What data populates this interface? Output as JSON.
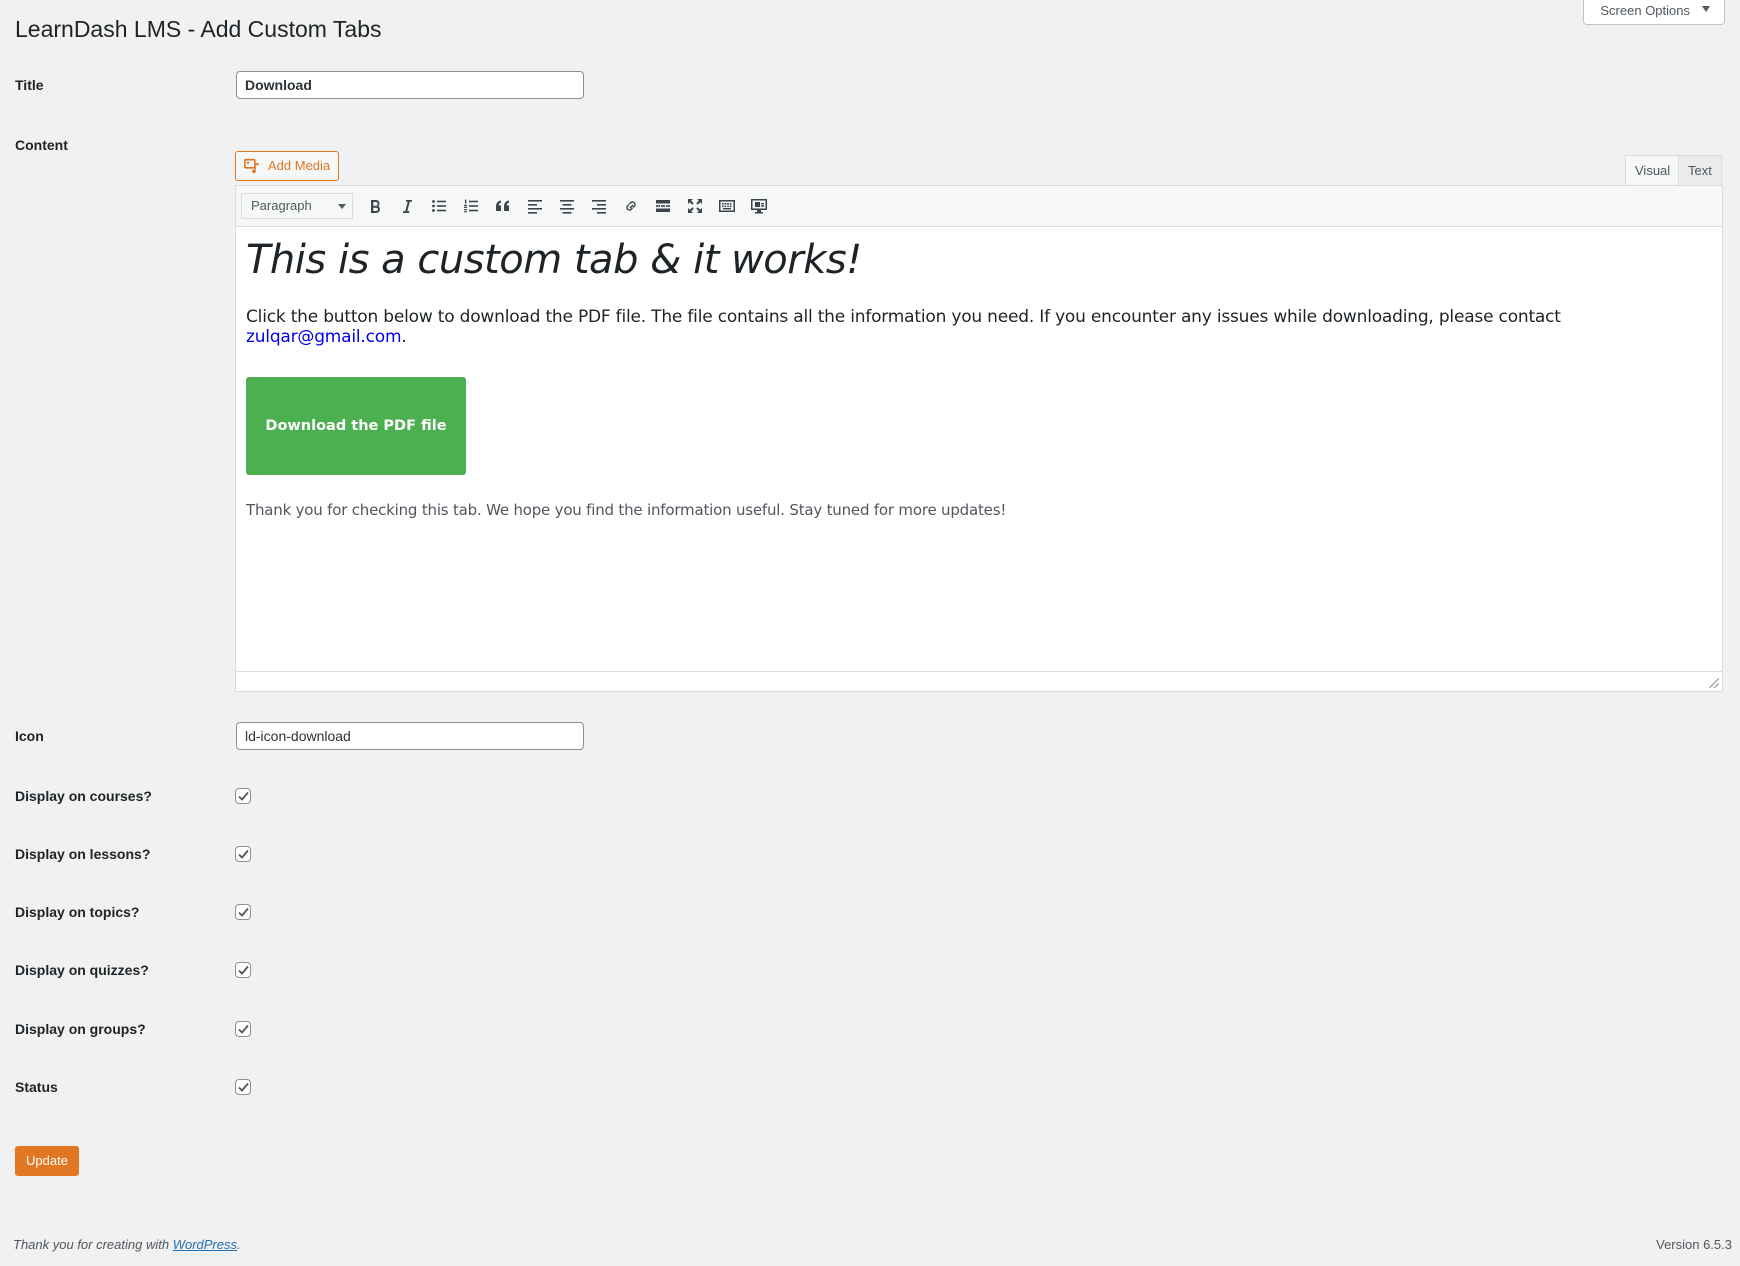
{
  "header": {
    "screen_options_label": "Screen Options",
    "page_title": "LearnDash LMS - Add Custom Tabs"
  },
  "form": {
    "title_label": "Title",
    "title_value": "Download",
    "content_label": "Content",
    "add_media_label": "Add Media",
    "editor_tabs": {
      "visual": "Visual",
      "text": "Text",
      "active": "Visual"
    },
    "toolbar": {
      "format_selected": "Paragraph",
      "buttons": [
        "bold-icon",
        "italic-icon",
        "bulleted-list-icon",
        "numbered-list-icon",
        "blockquote-icon",
        "align-left-icon",
        "align-center-icon",
        "align-right-icon",
        "link-icon",
        "read-more-icon",
        "fullscreen-icon",
        "toolbar-toggle-icon",
        "preview-icon"
      ]
    },
    "editor": {
      "heading": "This is a custom tab & it works!",
      "paragraph_prefix": "Click the button below to download the PDF file. The file contains all the information you need. If you encounter any issues while downloading, please contact ",
      "email": "zulqar@gmail.com",
      "paragraph_suffix": ".",
      "button_label": "Download the PDF file",
      "thanks": "Thank you for checking this tab. We hope you find the information useful. Stay tuned for more updates!"
    },
    "icon_label": "Icon",
    "icon_value": "ld-icon-download",
    "checkboxes": [
      {
        "label": "Display on courses?",
        "checked": true
      },
      {
        "label": "Display on lessons?",
        "checked": true
      },
      {
        "label": "Display on topics?",
        "checked": true
      },
      {
        "label": "Display on quizzes?",
        "checked": true
      },
      {
        "label": "Display on groups?",
        "checked": true
      },
      {
        "label": "Status",
        "checked": true
      }
    ],
    "update_label": "Update"
  },
  "footer": {
    "thanks_prefix": "Thank you for creating with ",
    "wordpress_link": "WordPress",
    "thanks_suffix": ".",
    "version": "Version 6.5.3"
  },
  "colors": {
    "accent": "#e17722",
    "button_green": "#4caf50",
    "link": "#2271b1"
  }
}
